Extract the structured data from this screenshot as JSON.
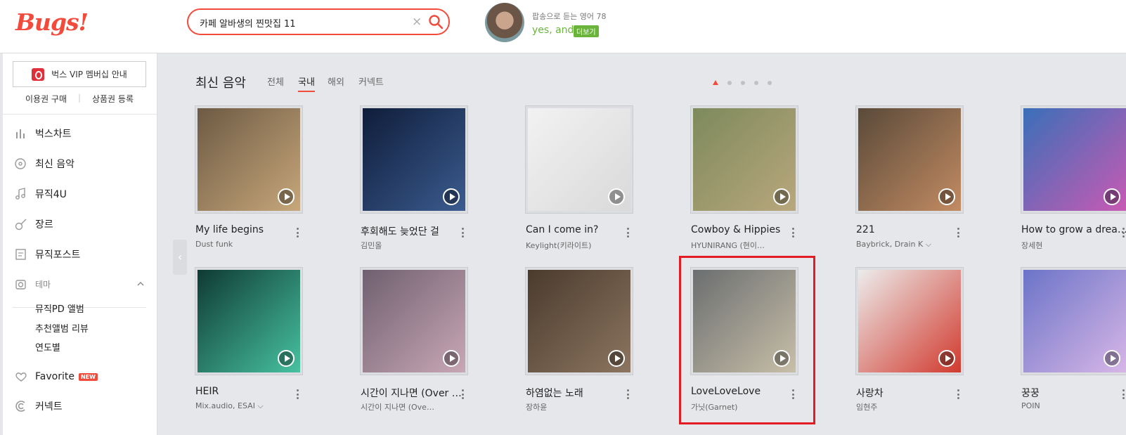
{
  "header": {
    "logo": "Bugs!",
    "search_value": "카페 알바생의 찐맛집 11",
    "clear_icon": "×",
    "promo_sub": "팝송으로 듣는 영어 78",
    "promo_main": "yes, and?",
    "promo_badge": "더보기"
  },
  "sidebar": {
    "vip_label": "벅스 VIP 멤버십 안내",
    "sub_link_1": "이용권 구매",
    "sub_link_2": "상품권 등록",
    "items": [
      {
        "label": "벅스차트",
        "icon": "chart-icon"
      },
      {
        "label": "최신 음악",
        "icon": "disc-icon"
      },
      {
        "label": "뮤직4U",
        "icon": "music-note-icon"
      },
      {
        "label": "장르",
        "icon": "guitar-icon"
      },
      {
        "label": "뮤직포스트",
        "icon": "post-icon"
      },
      {
        "label": "테마",
        "icon": "theme-icon"
      }
    ],
    "theme_sub": [
      "뮤직PD 앨범",
      "추천앨범 리뷰",
      "연도별"
    ],
    "favorite_label": "Favorite",
    "new_badge": "NEW",
    "connect_label": "커넥트"
  },
  "main": {
    "title": "최신 음악",
    "tabs": [
      "전체",
      "국내",
      "해외",
      "커넥트"
    ],
    "active_tab": 1,
    "page_count": 5,
    "active_page": 0
  },
  "albums": [
    {
      "title": "My life begins",
      "artist": "Dust funk",
      "colors": [
        "#6d5a44",
        "#c7a77a"
      ]
    },
    {
      "title": "후회해도 늦었단 걸",
      "artist": "김민올",
      "colors": [
        "#0f1d3a",
        "#3b5b8f"
      ]
    },
    {
      "title": "Can I come in?",
      "artist": "Keylight(키라이트)",
      "colors": [
        "#f2f2f2",
        "#d9d9d9"
      ]
    },
    {
      "title": "Cowboy & Hippies",
      "artist": "HYUNIRANG (현이…",
      "colors": [
        "#7d8a5c",
        "#b9a77d"
      ]
    },
    {
      "title": "221",
      "artist": "Baybrick, Drain K ⌵",
      "colors": [
        "#5a4a3a",
        "#c28b62"
      ]
    },
    {
      "title": "How to grow a drea…",
      "artist": "장세현",
      "colors": [
        "#3a6fb8",
        "#c85ab3"
      ]
    },
    {
      "title": "HEIR",
      "artist": "Mix.audio, ESAI ⌵",
      "colors": [
        "#0f3a33",
        "#47c2a0"
      ]
    },
    {
      "title": "시간이 지나면 (Over …",
      "artist": "시간이 지나면 (Ove…",
      "colors": [
        "#6f6070",
        "#c9a7b5"
      ]
    },
    {
      "title": "하염없는 노래",
      "artist": "장하윤",
      "colors": [
        "#4a3b2d",
        "#8c7560"
      ]
    },
    {
      "title": "LoveLoveLove",
      "artist": "가닛(Garnet)",
      "colors": [
        "#6b6e70",
        "#c8bfa8"
      ]
    },
    {
      "title": "사랑차",
      "artist": "임현주",
      "colors": [
        "#ececec",
        "#d13a2e"
      ]
    },
    {
      "title": "꿍꿍",
      "artist": "POIN",
      "colors": [
        "#6c74c8",
        "#d7b6e6"
      ]
    }
  ],
  "colors": {
    "accent": "#f24b3c",
    "highlight": "#e21b24",
    "promo_green": "#6ab43c"
  }
}
